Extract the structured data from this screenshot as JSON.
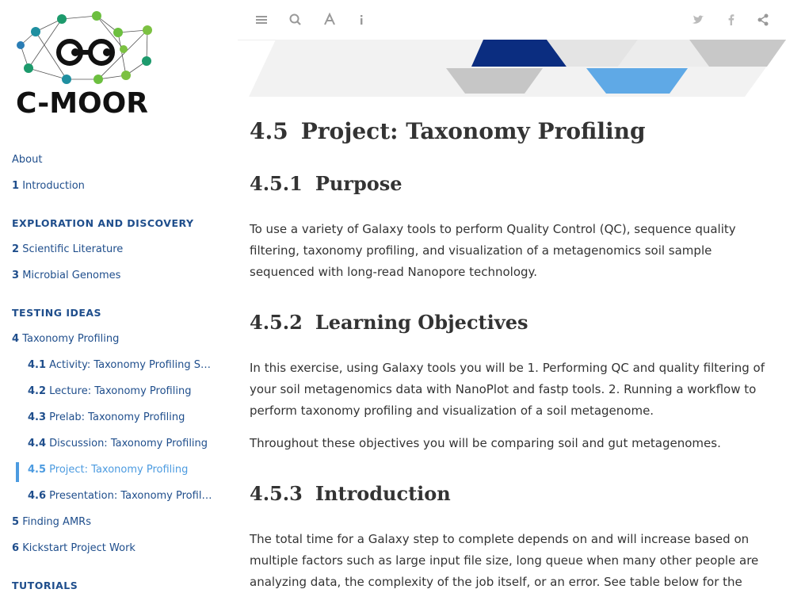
{
  "logo": {
    "text": "C-MOOR"
  },
  "toc": {
    "about": "About",
    "intro": {
      "num": "1",
      "label": "Introduction"
    },
    "part1": "EXPLORATION AND DISCOVERY",
    "ch2": {
      "num": "2",
      "label": "Scientific Literature"
    },
    "ch3": {
      "num": "3",
      "label": "Microbial Genomes"
    },
    "part2": "TESTING IDEAS",
    "ch4": {
      "num": "4",
      "label": "Taxonomy Profiling"
    },
    "s41": {
      "num": "4.1",
      "label": "Activity: Taxonomy Profiling Sprea…"
    },
    "s42": {
      "num": "4.2",
      "label": "Lecture: Taxonomy Profiling"
    },
    "s43": {
      "num": "4.3",
      "label": "Prelab: Taxonomy Profiling"
    },
    "s44": {
      "num": "4.4",
      "label": "Discussion: Taxonomy Profiling"
    },
    "s45": {
      "num": "4.5",
      "label": "Project: Taxonomy Profiling"
    },
    "s46": {
      "num": "4.6",
      "label": "Presentation: Taxonomy Profiling"
    },
    "ch5": {
      "num": "5",
      "label": "Finding AMRs"
    },
    "ch6": {
      "num": "6",
      "label": "Kickstart Project Work"
    },
    "part3": "TUTORIALS"
  },
  "toolbar": {
    "left_icons": [
      "toc-toggle-icon",
      "search-icon",
      "font-settings-icon",
      "info-icon"
    ],
    "right_icons": [
      "twitter-icon",
      "facebook-icon",
      "share-icon"
    ]
  },
  "content": {
    "title": {
      "num": "4.5",
      "text": "Project: Taxonomy Profiling"
    },
    "purpose": {
      "num": "4.5.1",
      "text": "Purpose"
    },
    "purpose_p": "To use a variety of Galaxy tools to perform Quality Control (QC), sequence quality filtering, taxonomy profiling, and visualization of a metagenomics soil sample sequenced with long-read Nanopore technology.",
    "objectives": {
      "num": "4.5.2",
      "text": "Learning Objectives"
    },
    "objectives_p1": "In this exercise, using Galaxy tools you will be 1. Performing QC and quality filtering of your soil metagenomics data with NanoPlot and fastp tools. 2. Running a workflow to perform taxonomy profiling and visualization of a soil metagenome.",
    "objectives_p2": "Throughout these objectives you will be comparing soil and gut metagenomes.",
    "intro": {
      "num": "4.5.3",
      "text": "Introduction"
    },
    "intro_p": "The total time for a Galaxy step to complete depends on and will increase based on multiple factors such as large input file size, long queue when many other people are analyzing data, the complexity of the job itself, or an error. See table below for the"
  },
  "colors": {
    "link": "#1f4e8c",
    "active": "#4c9be0",
    "text": "#333333"
  }
}
